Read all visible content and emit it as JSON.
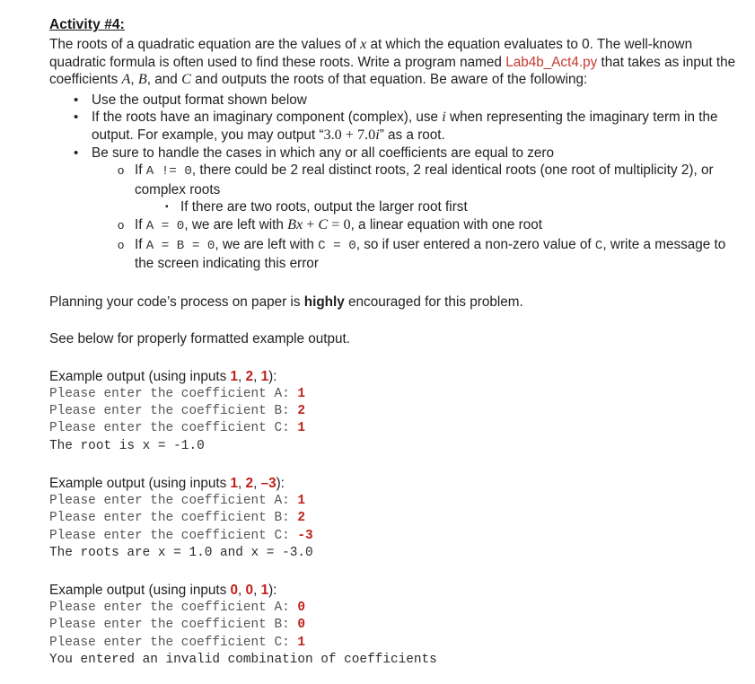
{
  "document": {
    "heading": "Activity #4:",
    "intro": {
      "part1": "The roots of a quadratic equation are the values of ",
      "var_x": "x",
      "part2": " at which the equation evaluates to 0. The well-known quadratic formula is often used to find these roots. Write a program named ",
      "filename": "Lab4b_Act4.py",
      "part3": " that takes as input the coefficients ",
      "var_a": "A",
      "comma1": ", ",
      "var_b": "B",
      "comma2": ", and ",
      "var_c": "C",
      "part4": " and outputs the roots of that equation. Be aware of the following:"
    },
    "bullets": {
      "b1": "Use the output format shown below",
      "b2_part1": "If the roots have an imaginary component (complex), use ",
      "b2_i": "i",
      "b2_part2": " when representing the imaginary term in the output. For example, you may output “",
      "b2_expr": "3.0 + 7.0",
      "b2_expr_i": "i",
      "b2_part3": "” as a root.",
      "b3": "Be sure to handle the cases in which any or all coefficients are equal to zero",
      "sub1_pre": "If ",
      "sub1_code": "A  !=  0",
      "sub1_post": ", there could be 2 real distinct roots, 2 real identical roots (one root of multiplicity 2), or complex roots",
      "sub1_sub": "If there are two roots, output the larger root first",
      "sub2_pre": "If ",
      "sub2_code": "A  =  0",
      "sub2_mid": ", we are left with ",
      "sub2_expr_it": "Bx",
      "sub2_expr_plus": " + ",
      "sub2_expr_c": "C",
      "sub2_expr_eq": " = 0",
      "sub2_post": ", a linear equation with one root",
      "sub3_pre": "If ",
      "sub3_code1": "A  =  B  =  0",
      "sub3_mid": ", we are left with ",
      "sub3_code2": "C  =  0",
      "sub3_mid2": ", so if user entered a non-zero value of ",
      "sub3_code3": "C",
      "sub3_post": ", write a message to the screen indicating this error"
    },
    "planning": {
      "part1": "Planning your code’s process on paper is ",
      "emphasis": "highly",
      "part2": " encouraged for this problem."
    },
    "see_below": "See below for properly formatted example output.",
    "examples": [
      {
        "label_prefix": "Example output (using inputs ",
        "inputs": [
          "1",
          "2",
          "1"
        ],
        "label_suffix": "):",
        "lines": [
          {
            "prompt": "Please enter the coefficient A: ",
            "value": "1"
          },
          {
            "prompt": "Please enter the coefficient B: ",
            "value": "2"
          },
          {
            "prompt": "Please enter the coefficient C: ",
            "value": "1"
          }
        ],
        "result": "The root is x = -1.0"
      },
      {
        "label_prefix": "Example output (using inputs ",
        "inputs": [
          "1",
          "2",
          "–3"
        ],
        "label_suffix": "):",
        "lines": [
          {
            "prompt": "Please enter the coefficient A: ",
            "value": "1"
          },
          {
            "prompt": "Please enter the coefficient B: ",
            "value": "2"
          },
          {
            "prompt": "Please enter the coefficient C: ",
            "value": "-3"
          }
        ],
        "result": "The roots are x = 1.0 and x = -3.0"
      },
      {
        "label_prefix": "Example output (using inputs ",
        "inputs": [
          "0",
          "0",
          "1"
        ],
        "label_suffix": "):",
        "lines": [
          {
            "prompt": "Please enter the coefficient A: ",
            "value": "0"
          },
          {
            "prompt": "Please enter the coefficient B: ",
            "value": "0"
          },
          {
            "prompt": "Please enter the coefficient C: ",
            "value": "1"
          }
        ],
        "result": "You entered an invalid combination of coefficients"
      }
    ],
    "bullet_glyphs": {
      "disc": "•",
      "circle": "o",
      "square": "▪"
    },
    "colors": {
      "filename_red": "#C43B32",
      "value_red": "#C0201A",
      "console_gray": "#555555",
      "body": "#222222"
    }
  }
}
